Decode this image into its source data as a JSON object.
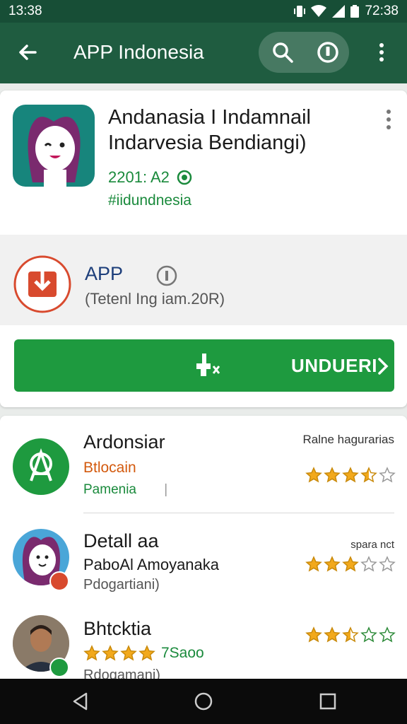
{
  "status_bar": {
    "time_left": "13:38",
    "time_right": "72:38"
  },
  "app_bar": {
    "title": "APP Indonesia",
    "back_icon": "arrow-back-icon",
    "search_icon": "search-icon",
    "target_icon": "radio-target-icon",
    "more_icon": "more-vert-icon"
  },
  "header": {
    "name_line1": "Andanasia I Indamnail",
    "name_line2": "Indarvesia Bendiangi)",
    "meta1": "2201: A2",
    "meta2": "#iidundnesia",
    "colors": {
      "accent_green": "#1a8a3c",
      "appbar": "#1f5c40"
    }
  },
  "download": {
    "title": "APP",
    "subtitle": "(Tetenl Ing iam.20R)",
    "icon": "download-icon",
    "info_icon": "info-icon"
  },
  "install_button": {
    "label": "UNDUERI",
    "icon": "install-figure-icon",
    "chevron_icon": "chevron-right-icon",
    "color": "#1e9a3f"
  },
  "list": [
    {
      "title": "Ardonsiar",
      "subtitle": "Btlocain",
      "detail": "Pamenia",
      "detail_mark": "|",
      "right_label": "Ralne hagurarias",
      "rating": 3.5
    },
    {
      "title": "Detall aa",
      "subtitle": "PaboAl Amoyanaka",
      "detail": "Pdogartiani)",
      "right_label": "spara nct",
      "rating": 3
    },
    {
      "title": "Bhtcktia",
      "subtitle_rating_text": "7Saoo",
      "detail": "Rdogamani)",
      "rating": 2.5,
      "inline_rating": 4
    }
  ],
  "nav": {
    "back": "nav-back-icon",
    "home": "nav-home-icon",
    "recents": "nav-recents-icon"
  }
}
